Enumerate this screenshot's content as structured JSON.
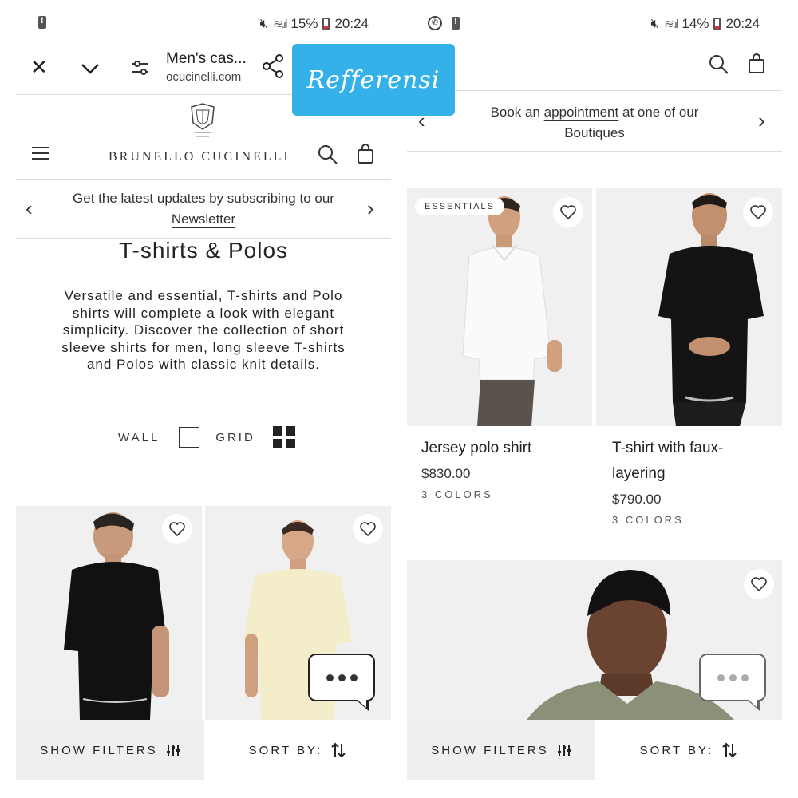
{
  "left": {
    "status": {
      "battery": "15%",
      "time": "20:24"
    },
    "browser": {
      "title": "Men's cas...",
      "url": "ocucinelli.com"
    },
    "brand": {
      "name": "BRUNELLO CUCINELLI"
    },
    "banner": {
      "text": "Get the latest updates by subscribing to our",
      "link": "Newsletter"
    },
    "page": {
      "title": "T-shirts & Polos",
      "description": "Versatile and essential, T-shirts and Polo shirts will complete a look with elegant simplicity. Discover the collection of short sleeve shirts for men, long sleeve T-shirts and Polos with classic knit details."
    },
    "view": {
      "wall": "WALL",
      "grid": "GRID"
    },
    "filters": {
      "show": "SHOW FILTERS",
      "sort": "SORT BY:"
    }
  },
  "right": {
    "status": {
      "battery": "14%",
      "time": "20:24"
    },
    "banner": {
      "text_before": "Book an",
      "link": "appointment",
      "text_after": "at one of our",
      "line2": "Boutiques"
    },
    "products": [
      {
        "name": "Jersey polo shirt",
        "price": "$830.00",
        "colors": "3 COLORS",
        "badge": "ESSENTIALS"
      },
      {
        "name_line1": "T-shirt with faux-",
        "name_line2": "layering",
        "price": "$790.00",
        "colors": "3 COLORS"
      }
    ],
    "filters": {
      "show": "SHOW FILTERS",
      "sort": "SORT BY:"
    }
  },
  "overlay": {
    "label": "Refferensi"
  },
  "icons": [
    "close-icon",
    "chevron-down-icon",
    "site-settings-icon",
    "share-icon",
    "menu-icon",
    "search-icon",
    "bag-icon",
    "heart-icon",
    "filter-icon",
    "sort-icon",
    "chat-icon"
  ]
}
